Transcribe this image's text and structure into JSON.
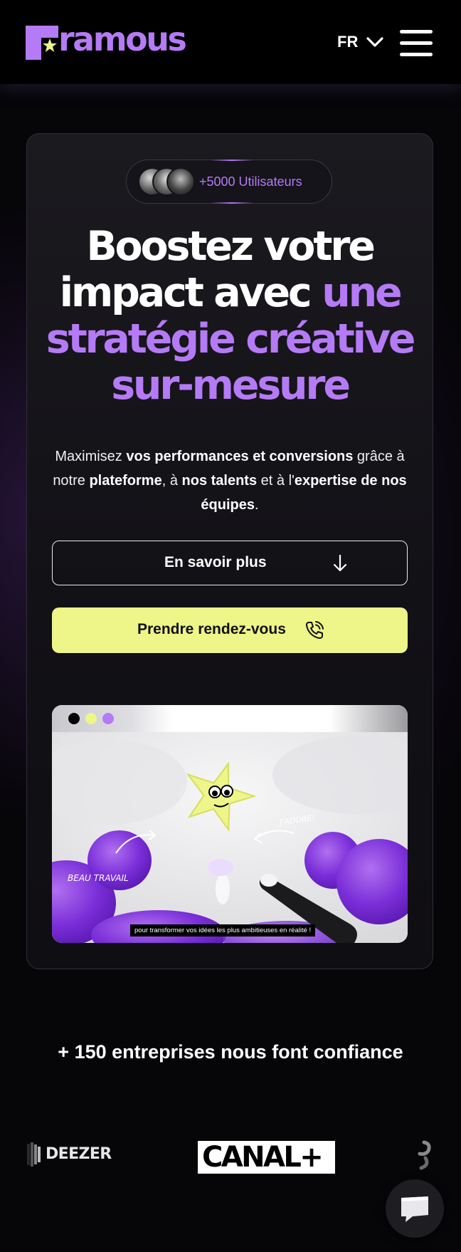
{
  "header": {
    "brand": "ramous",
    "language": {
      "code": "FR"
    }
  },
  "hero": {
    "users_badge": "+5000 Utilisateurs",
    "headline": {
      "line1": "Boostez votre",
      "line2_white": "impact avec",
      "line2_accent": "une",
      "line3": "stratégie créative",
      "line4": "sur-mesure"
    },
    "subtext": {
      "p1": "Maximisez ",
      "b1": "vos performances et conversions",
      "p2": " grâce à notre ",
      "b2": "plateforme",
      "p3": ", à ",
      "b3": "nos talents",
      "p4": " et à l'",
      "b4": "expertise de nos équipes",
      "p5": "."
    },
    "cta_secondary": "En savoir plus",
    "cta_primary": "Prendre rendez-vous"
  },
  "video": {
    "label_left": "BEAU TRAVAIL",
    "label_right": "J'ADORE!",
    "caption": "pour transformer vos idées les plus ambitieuses en réalité !"
  },
  "trust": {
    "title": "+ 150 entreprises nous font confiance",
    "logos": [
      "DEEZER",
      "CANAL+"
    ]
  },
  "colors": {
    "accent_purple": "#b57af5",
    "cta_yellow": "#eef589",
    "background": "#060508"
  },
  "icons": [
    "star-icon",
    "chevron-down-icon",
    "menu-icon",
    "arrow-down-icon",
    "phone-icon",
    "chat-icon"
  ]
}
